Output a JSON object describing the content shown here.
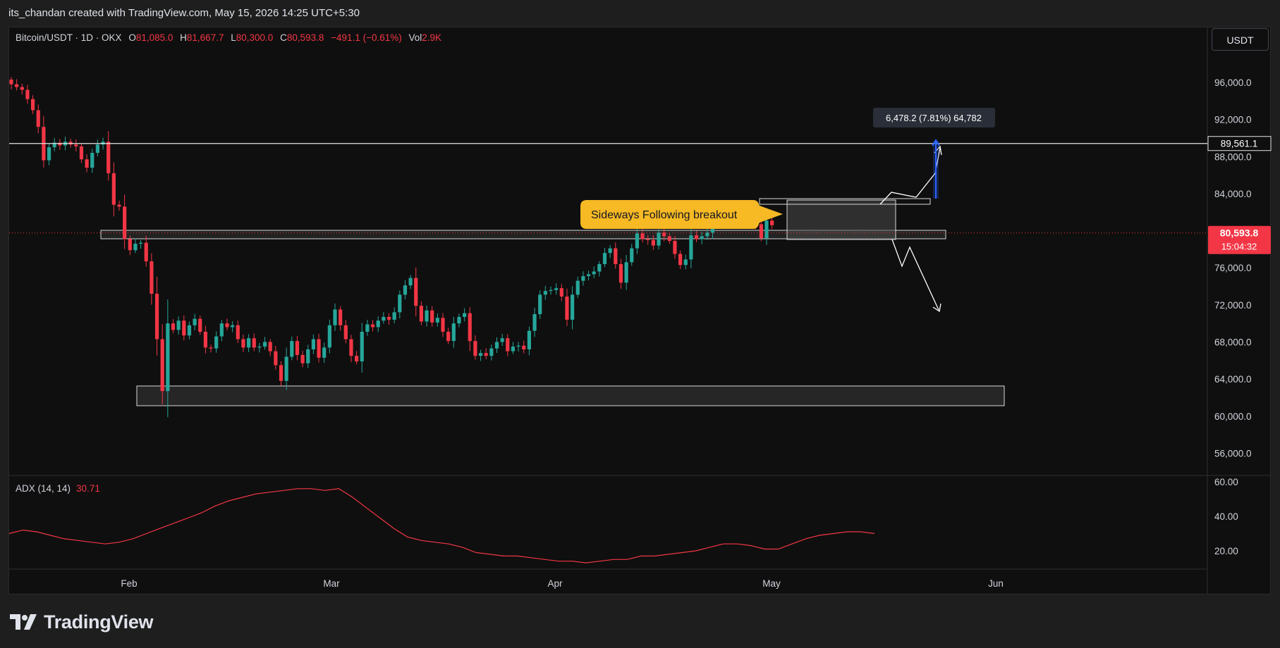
{
  "header": {
    "attribution": "its_chandan created with TradingView.com, May 15, 2026 14:25 UTC+5:30"
  },
  "legend": {
    "symbol": "Bitcoin/USDT · 1D · OKX",
    "open_label": "O",
    "open": "81,085.0",
    "high_label": "H",
    "high": "81,667.7",
    "low_label": "L",
    "low": "80,300.0",
    "close_label": "C",
    "close": "80,593.8",
    "change": "−491.1 (−0.61%)",
    "vol_label": "Vol",
    "vol": "2.9K"
  },
  "currency_button": "USDT",
  "adx_legend": {
    "label": "ADX (14, 14)",
    "value": "30.71"
  },
  "brand": {
    "name": "TradingView"
  },
  "colors": {
    "up": "#26a69a",
    "down": "#f23645",
    "adx": "#f23645",
    "callout": "#f7b924",
    "target": "#2962ff"
  },
  "annotations": {
    "callout": "Sideways Following breakout",
    "measure": "6,478.2 (7.81%) 64,782",
    "resistance_price": "89,561.1",
    "last_price": "80,593.8",
    "countdown": "15:04:32"
  },
  "chart_data": {
    "type": "candlestick",
    "price_axis": {
      "ticks": [
        "96,000.0",
        "92,000.0",
        "88,000.0",
        "84,000.0",
        "76,000.0",
        "72,000.0",
        "68,000.0",
        "64,000.0",
        "60,000.0",
        "56,000.0"
      ]
    },
    "time_axis": {
      "ticks": [
        "Feb",
        "Mar",
        "Apr",
        "May",
        "Jun"
      ]
    },
    "candles_close": [
      95800,
      95500,
      95200,
      94200,
      93000,
      91200,
      87600,
      89000,
      89500,
      89200,
      89600,
      89300,
      89100,
      87700,
      86800,
      88400,
      89300,
      89600,
      86200,
      82800,
      82600,
      79100,
      77900,
      78600,
      78700,
      76700,
      73200,
      68300,
      62700,
      70000,
      69300,
      70300,
      68700,
      69800,
      70500,
      69100,
      67400,
      67300,
      68600,
      70000,
      69600,
      69800,
      68300,
      67400,
      68400,
      67400,
      67500,
      68000,
      67000,
      65500,
      63800,
      66400,
      68100,
      66600,
      65700,
      67200,
      68300,
      66300,
      67400,
      69800,
      71500,
      69800,
      68300,
      66500,
      65900,
      69100,
      69900,
      69600,
      70300,
      70700,
      70400,
      71200,
      73100,
      74100,
      74900,
      71900,
      70200,
      71400,
      70100,
      70600,
      69100,
      68100,
      70000,
      70700,
      71100,
      68100,
      66500,
      66800,
      66500,
      67300,
      68000,
      68400,
      67000,
      67500,
      67600,
      67200,
      69200,
      71000,
      73100,
      73500,
      73600,
      73800,
      72900,
      70400,
      73100,
      74600,
      75100,
      75300,
      75600,
      76400,
      77600,
      78100,
      76400,
      74400,
      76600,
      78100,
      79700,
      79100,
      79000,
      78400,
      79800,
      79400,
      78900,
      77500,
      76300,
      76900,
      79500,
      79100,
      79400,
      79800,
      81800,
      81200,
      82400,
      81400,
      80900,
      82300,
      81700,
      81500,
      80700,
      79200,
      81100,
      80594
    ],
    "adx_series": [
      30,
      32,
      31,
      29,
      27,
      26,
      25,
      24,
      25,
      27,
      30,
      33,
      36,
      39,
      42,
      46,
      49,
      51,
      53,
      54,
      55,
      56,
      56,
      55,
      56,
      51,
      45,
      39,
      33,
      28,
      26,
      25,
      24,
      22,
      19,
      18,
      17,
      17,
      16,
      15,
      14,
      14,
      13,
      14,
      15,
      15,
      17,
      17,
      18,
      19,
      20,
      22,
      24,
      24,
      23,
      21,
      21,
      24,
      27,
      29,
      30,
      31,
      31,
      30
    ],
    "adx_axis": {
      "ticks": [
        "60.00",
        "40.00",
        "20.00"
      ]
    },
    "levels": {
      "resistance": 89561.1,
      "last": 80593.8
    },
    "measure": {
      "from": 82300,
      "to": 89100
    }
  }
}
